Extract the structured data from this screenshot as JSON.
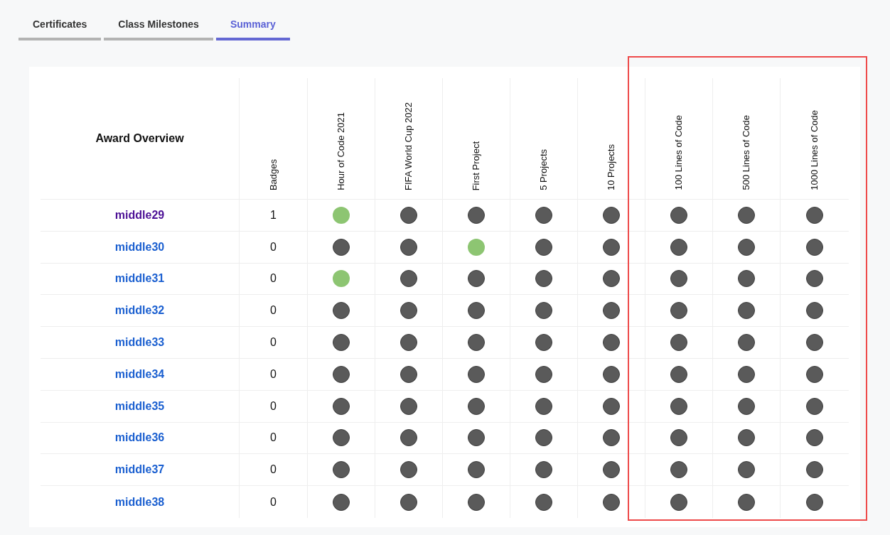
{
  "tabs": [
    {
      "label": "Certificates",
      "selected": false
    },
    {
      "label": "Class Milestones",
      "selected": false
    },
    {
      "label": "Summary",
      "selected": true
    }
  ],
  "table": {
    "title": "Award Overview",
    "columns": [
      {
        "label": "Badges",
        "highlighted": false
      },
      {
        "label": "Hour of Code 2021",
        "highlighted": false
      },
      {
        "label": "FIFA World Cup 2022",
        "highlighted": false
      },
      {
        "label": "First Project",
        "highlighted": false
      },
      {
        "label": "5 Projects",
        "highlighted": false
      },
      {
        "label": "10 Projects",
        "highlighted": false
      },
      {
        "label": "100 Lines of Code",
        "highlighted": true
      },
      {
        "label": "500 Lines of Code",
        "highlighted": true
      },
      {
        "label": "1000 Lines of Code",
        "highlighted": true
      }
    ],
    "rows": [
      {
        "name": "middle29",
        "visited": true,
        "badges": "1",
        "earned": [
          true,
          false,
          false,
          false,
          false,
          false,
          false,
          false
        ]
      },
      {
        "name": "middle30",
        "visited": false,
        "badges": "0",
        "earned": [
          false,
          false,
          true,
          false,
          false,
          false,
          false,
          false
        ]
      },
      {
        "name": "middle31",
        "visited": false,
        "badges": "0",
        "earned": [
          true,
          false,
          false,
          false,
          false,
          false,
          false,
          false
        ]
      },
      {
        "name": "middle32",
        "visited": false,
        "badges": "0",
        "earned": [
          false,
          false,
          false,
          false,
          false,
          false,
          false,
          false
        ]
      },
      {
        "name": "middle33",
        "visited": false,
        "badges": "0",
        "earned": [
          false,
          false,
          false,
          false,
          false,
          false,
          false,
          false
        ]
      },
      {
        "name": "middle34",
        "visited": false,
        "badges": "0",
        "earned": [
          false,
          false,
          false,
          false,
          false,
          false,
          false,
          false
        ]
      },
      {
        "name": "middle35",
        "visited": false,
        "badges": "0",
        "earned": [
          false,
          false,
          false,
          false,
          false,
          false,
          false,
          false
        ]
      },
      {
        "name": "middle36",
        "visited": false,
        "badges": "0",
        "earned": [
          false,
          false,
          false,
          false,
          false,
          false,
          false,
          false
        ]
      },
      {
        "name": "middle37",
        "visited": false,
        "badges": "0",
        "earned": [
          false,
          false,
          false,
          false,
          false,
          false,
          false,
          false
        ]
      },
      {
        "name": "middle38",
        "visited": false,
        "badges": "0",
        "earned": [
          false,
          false,
          false,
          false,
          false,
          false,
          false,
          false
        ]
      }
    ]
  }
}
